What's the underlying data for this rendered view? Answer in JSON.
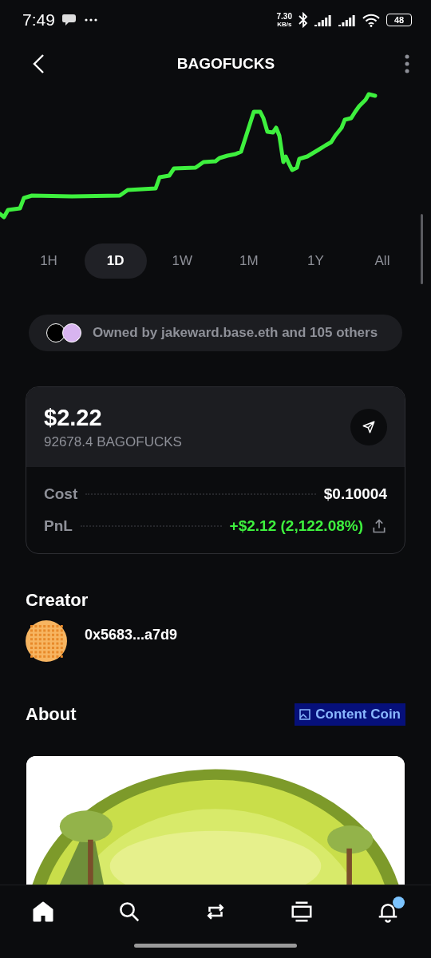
{
  "status_bar": {
    "time": "7:49",
    "speed_value": "7.30",
    "speed_unit": "KB/s",
    "battery": "48"
  },
  "header": {
    "title": "BAGOFUCKS"
  },
  "ranges": [
    {
      "label": "1H",
      "selected": false
    },
    {
      "label": "1D",
      "selected": true
    },
    {
      "label": "1W",
      "selected": false
    },
    {
      "label": "1M",
      "selected": false
    },
    {
      "label": "1Y",
      "selected": false
    },
    {
      "label": "All",
      "selected": false
    }
  ],
  "owners": {
    "text": "Owned by jakeward.base.eth and 105 others"
  },
  "holding": {
    "value": "$2.22",
    "amount": "92678.4 BAGOFUCKS",
    "rows": [
      {
        "label": "Cost",
        "value": "$0.10004",
        "kind": "plain"
      },
      {
        "label": "PnL",
        "value": "+$2.12 (2,122.08%)",
        "kind": "gain"
      }
    ]
  },
  "creator": {
    "heading": "Creator",
    "address": "0x5683...a7d9"
  },
  "about": {
    "heading": "About",
    "badge": "Content Coin"
  },
  "nav": [
    {
      "kind": "home",
      "selected": true
    },
    {
      "kind": "search",
      "selected": false
    },
    {
      "kind": "swap",
      "selected": false
    },
    {
      "kind": "feed",
      "selected": false
    },
    {
      "kind": "notifications",
      "selected": false,
      "badge": true
    }
  ]
}
